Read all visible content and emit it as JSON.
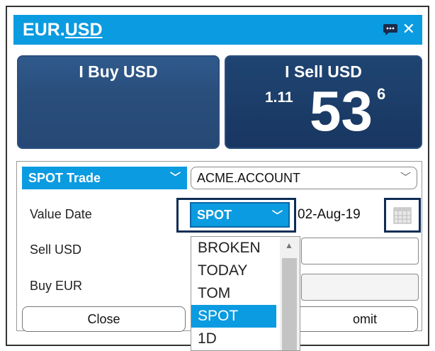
{
  "ticket": {
    "pair_base": "EUR",
    "pair_sep": ".",
    "pair_quote": "USD",
    "buy_label": "I Buy USD",
    "sell_label": "I Sell USD",
    "sell_price": {
      "big_figure": "1.11",
      "pips": "53",
      "fractional_pip": "6"
    }
  },
  "form": {
    "trade_type": "SPOT Trade",
    "account": "ACME.ACCOUNT",
    "value_date_label": "Value Date",
    "tenor": "SPOT",
    "value_date": "02-Aug-19",
    "sell_label": "Sell USD",
    "buy_label": "Buy EUR",
    "close_button": "Close",
    "submit_button": "omit"
  },
  "tenor_dropdown": {
    "options": [
      "BROKEN",
      "TODAY",
      "TOM",
      "SPOT",
      "1D"
    ],
    "selected": "SPOT"
  },
  "colors": {
    "accent": "#0b9be0",
    "buy_panel": "#2a4e7c",
    "sell_panel": "#1d3f6b",
    "focus_outline": "#0f2d55"
  }
}
